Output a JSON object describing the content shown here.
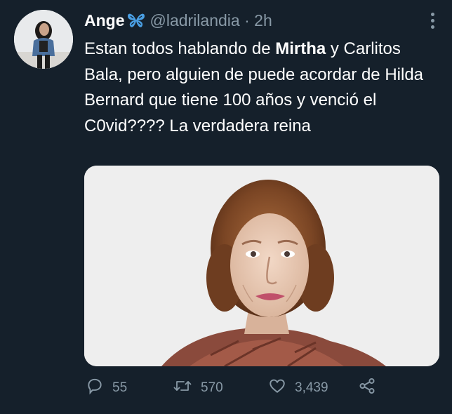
{
  "tweet": {
    "author_name": "Ange",
    "author_emoji_icon": "butterfly-icon",
    "handle": "@ladrilandia",
    "separator": "·",
    "time": "2h",
    "text_part1": "Estan todos hablando de ",
    "text_bold": "Mirtha",
    "text_part2": " y Carlitos Bala, pero alguien de puede acordar de Hilda Bernard que tiene 100 años y venció el C0vid???? La verdadera reina"
  },
  "actions": {
    "replies": "55",
    "retweets": "570",
    "likes": "3,439"
  },
  "colors": {
    "background": "#15202b",
    "secondary_text": "#8899a6",
    "emoji_blue": "#4a9fe3"
  }
}
